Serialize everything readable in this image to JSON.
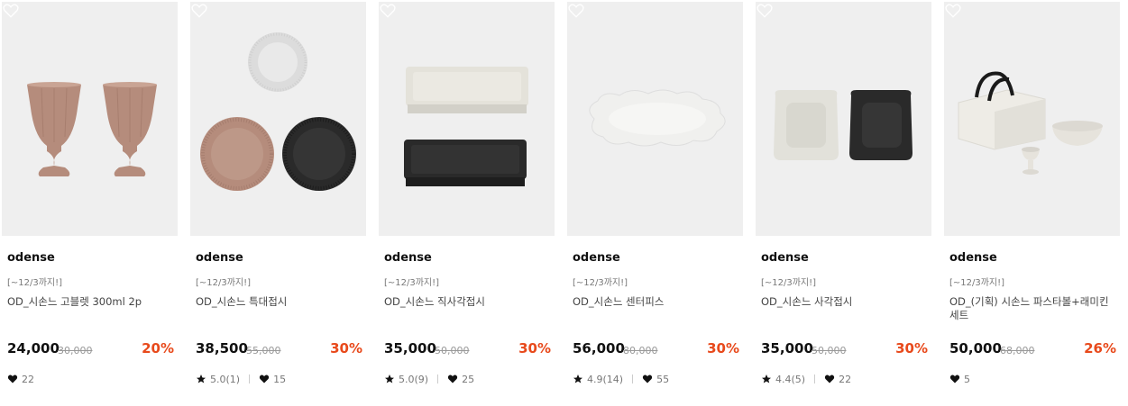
{
  "products": [
    {
      "brand": "odense",
      "promo": "[~12/3까지!]",
      "name": "OD_시손느 고블렛 300ml 2p",
      "price": "24,000",
      "original_price": "30,000",
      "discount": "20%",
      "rating": "",
      "likes": "22"
    },
    {
      "brand": "odense",
      "promo": "[~12/3까지!]",
      "name": "OD_시손느 특대접시",
      "price": "38,500",
      "original_price": "55,000",
      "discount": "30%",
      "rating": "5.0(1)",
      "likes": "15"
    },
    {
      "brand": "odense",
      "promo": "[~12/3까지!]",
      "name": "OD_시손느 직사각접시",
      "price": "35,000",
      "original_price": "50,000",
      "discount": "30%",
      "rating": "5.0(9)",
      "likes": "25"
    },
    {
      "brand": "odense",
      "promo": "[~12/3까지!]",
      "name": "OD_시손느 센터피스",
      "price": "56,000",
      "original_price": "80,000",
      "discount": "30%",
      "rating": "4.9(14)",
      "likes": "55"
    },
    {
      "brand": "odense",
      "promo": "[~12/3까지!]",
      "name": "OD_시손느 사각접시",
      "price": "35,000",
      "original_price": "50,000",
      "discount": "30%",
      "rating": "4.4(5)",
      "likes": "22"
    },
    {
      "brand": "odense",
      "promo": "[~12/3까지!]",
      "name": "OD_(기획) 시손느 파스타볼+래미킨 세트",
      "price": "50,000",
      "original_price": "68,000",
      "discount": "26%",
      "rating": "",
      "likes": "5"
    }
  ],
  "colors": {
    "discount": "#e84a1c",
    "thumb_bg": "#efefef",
    "terracotta": "#b58c7c",
    "ivory": "#e4e2da",
    "black": "#2a2a2a"
  },
  "icons": {
    "wishlist": "heart-outline-icon",
    "rating": "star-icon",
    "likes": "heart-filled-icon"
  }
}
